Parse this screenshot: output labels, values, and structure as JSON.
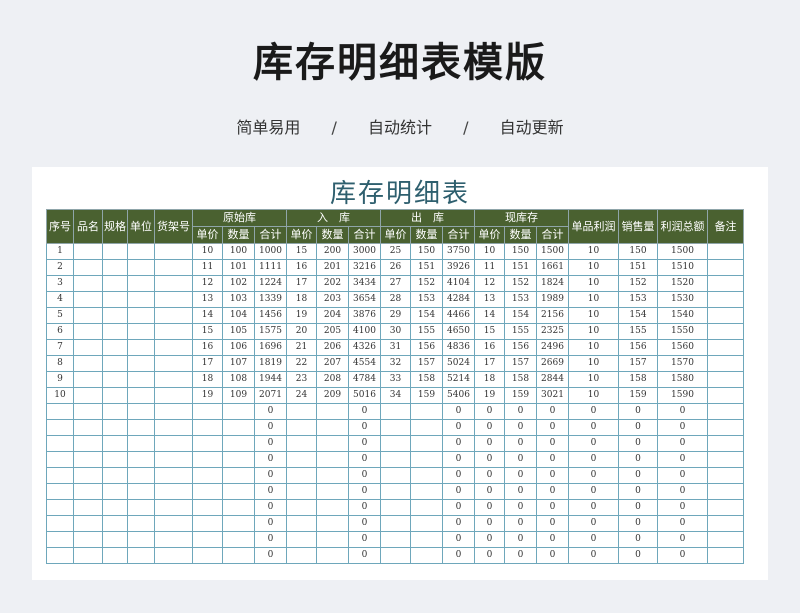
{
  "page": {
    "title": "库存明细表模版",
    "features": [
      "简单易用",
      "自动统计",
      "自动更新"
    ],
    "separator": "/"
  },
  "sheet": {
    "title": "库存明细表",
    "headers": {
      "seq": "序号",
      "name": "品名",
      "spec": "规格",
      "unit": "单位",
      "shelf": "货架号",
      "original": "原始库",
      "inbound": "入　库",
      "outbound": "出　库",
      "current": "现库存",
      "unit_profit": "单品利润",
      "sales_qty": "销售量",
      "total_profit": "利润总额",
      "remark": "备注",
      "price": "单价",
      "qty": "数量",
      "total": "合计"
    },
    "rows": [
      [
        "1",
        "",
        "",
        "",
        "",
        "10",
        "100",
        "1000",
        "15",
        "200",
        "3000",
        "25",
        "150",
        "3750",
        "10",
        "150",
        "1500",
        "10",
        "150",
        "1500",
        ""
      ],
      [
        "2",
        "",
        "",
        "",
        "",
        "11",
        "101",
        "1111",
        "16",
        "201",
        "3216",
        "26",
        "151",
        "3926",
        "11",
        "151",
        "1661",
        "10",
        "151",
        "1510",
        ""
      ],
      [
        "3",
        "",
        "",
        "",
        "",
        "12",
        "102",
        "1224",
        "17",
        "202",
        "3434",
        "27",
        "152",
        "4104",
        "12",
        "152",
        "1824",
        "10",
        "152",
        "1520",
        ""
      ],
      [
        "4",
        "",
        "",
        "",
        "",
        "13",
        "103",
        "1339",
        "18",
        "203",
        "3654",
        "28",
        "153",
        "4284",
        "13",
        "153",
        "1989",
        "10",
        "153",
        "1530",
        ""
      ],
      [
        "5",
        "",
        "",
        "",
        "",
        "14",
        "104",
        "1456",
        "19",
        "204",
        "3876",
        "29",
        "154",
        "4466",
        "14",
        "154",
        "2156",
        "10",
        "154",
        "1540",
        ""
      ],
      [
        "6",
        "",
        "",
        "",
        "",
        "15",
        "105",
        "1575",
        "20",
        "205",
        "4100",
        "30",
        "155",
        "4650",
        "15",
        "155",
        "2325",
        "10",
        "155",
        "1550",
        ""
      ],
      [
        "7",
        "",
        "",
        "",
        "",
        "16",
        "106",
        "1696",
        "21",
        "206",
        "4326",
        "31",
        "156",
        "4836",
        "16",
        "156",
        "2496",
        "10",
        "156",
        "1560",
        ""
      ],
      [
        "8",
        "",
        "",
        "",
        "",
        "17",
        "107",
        "1819",
        "22",
        "207",
        "4554",
        "32",
        "157",
        "5024",
        "17",
        "157",
        "2669",
        "10",
        "157",
        "1570",
        ""
      ],
      [
        "9",
        "",
        "",
        "",
        "",
        "18",
        "108",
        "1944",
        "23",
        "208",
        "4784",
        "33",
        "158",
        "5214",
        "18",
        "158",
        "2844",
        "10",
        "158",
        "1580",
        ""
      ],
      [
        "10",
        "",
        "",
        "",
        "",
        "19",
        "109",
        "2071",
        "24",
        "209",
        "5016",
        "34",
        "159",
        "5406",
        "19",
        "159",
        "3021",
        "10",
        "159",
        "1590",
        ""
      ],
      [
        "",
        "",
        "",
        "",
        "",
        "",
        "",
        "0",
        "",
        "",
        "0",
        "",
        "",
        "0",
        "0",
        "0",
        "0",
        "0",
        "0",
        "0",
        ""
      ],
      [
        "",
        "",
        "",
        "",
        "",
        "",
        "",
        "0",
        "",
        "",
        "0",
        "",
        "",
        "0",
        "0",
        "0",
        "0",
        "0",
        "0",
        "0",
        ""
      ],
      [
        "",
        "",
        "",
        "",
        "",
        "",
        "",
        "0",
        "",
        "",
        "0",
        "",
        "",
        "0",
        "0",
        "0",
        "0",
        "0",
        "0",
        "0",
        ""
      ],
      [
        "",
        "",
        "",
        "",
        "",
        "",
        "",
        "0",
        "",
        "",
        "0",
        "",
        "",
        "0",
        "0",
        "0",
        "0",
        "0",
        "0",
        "0",
        ""
      ],
      [
        "",
        "",
        "",
        "",
        "",
        "",
        "",
        "0",
        "",
        "",
        "0",
        "",
        "",
        "0",
        "0",
        "0",
        "0",
        "0",
        "0",
        "0",
        ""
      ],
      [
        "",
        "",
        "",
        "",
        "",
        "",
        "",
        "0",
        "",
        "",
        "0",
        "",
        "",
        "0",
        "0",
        "0",
        "0",
        "0",
        "0",
        "0",
        ""
      ],
      [
        "",
        "",
        "",
        "",
        "",
        "",
        "",
        "0",
        "",
        "",
        "0",
        "",
        "",
        "0",
        "0",
        "0",
        "0",
        "0",
        "0",
        "0",
        ""
      ],
      [
        "",
        "",
        "",
        "",
        "",
        "",
        "",
        "0",
        "",
        "",
        "0",
        "",
        "",
        "0",
        "0",
        "0",
        "0",
        "0",
        "0",
        "0",
        ""
      ],
      [
        "",
        "",
        "",
        "",
        "",
        "",
        "",
        "0",
        "",
        "",
        "0",
        "",
        "",
        "0",
        "0",
        "0",
        "0",
        "0",
        "0",
        "0",
        ""
      ],
      [
        "",
        "",
        "",
        "",
        "",
        "",
        "",
        "0",
        "",
        "",
        "0",
        "",
        "",
        "0",
        "0",
        "0",
        "0",
        "0",
        "0",
        "0",
        ""
      ]
    ]
  }
}
